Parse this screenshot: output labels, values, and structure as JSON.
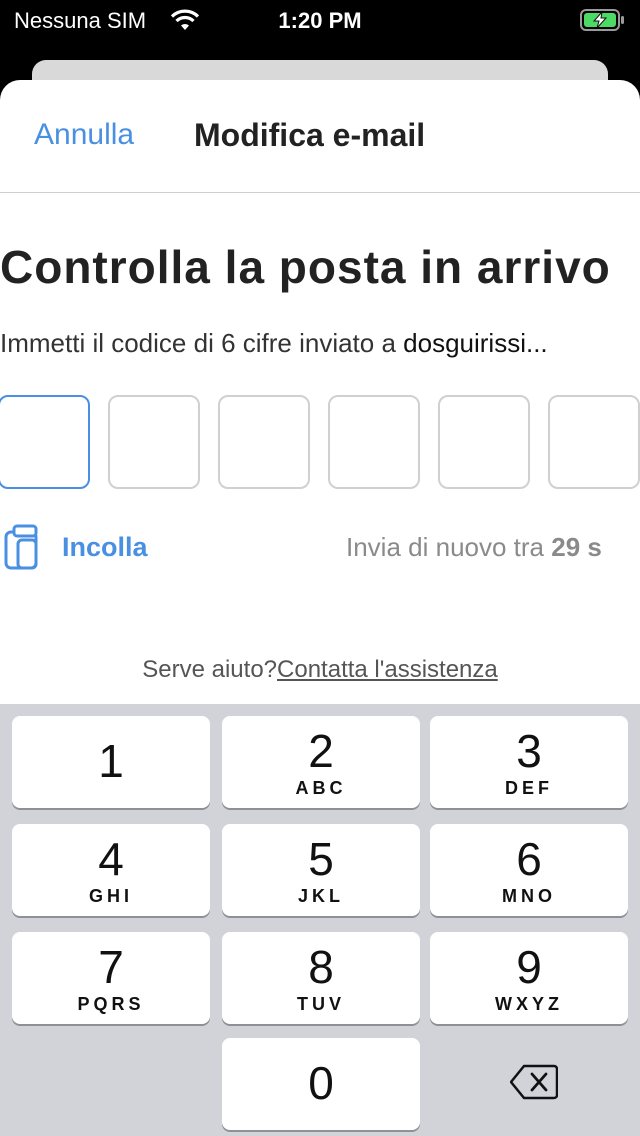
{
  "status_bar": {
    "carrier": "Nessuna SIM",
    "time": "1:20 PM",
    "wifi_icon": "wifi-icon",
    "battery_icon": "battery-charging-icon"
  },
  "nav": {
    "cancel_label": "Annulla",
    "title": "Modifica e-mail"
  },
  "main": {
    "heading": "Controlla la posta in arrivo",
    "subtext_prefix": "Immetti il codice di 6 cifre inviato a ",
    "email": "dosguirissi...",
    "code_boxes": [
      "",
      "",
      "",
      "",
      "",
      ""
    ],
    "paste_label": "Incolla",
    "resend_prefix": "Invia di nuovo tra ",
    "resend_seconds": "29 s",
    "help_prefix": "Serve aiuto?",
    "help_link": "Contatta l'assistenza"
  },
  "keyboard": {
    "keys": [
      {
        "num": "1",
        "letters": ""
      },
      {
        "num": "2",
        "letters": "ABC"
      },
      {
        "num": "3",
        "letters": "DEF"
      },
      {
        "num": "4",
        "letters": "GHI"
      },
      {
        "num": "5",
        "letters": "JKL"
      },
      {
        "num": "6",
        "letters": "MNO"
      },
      {
        "num": "7",
        "letters": "PQRS"
      },
      {
        "num": "8",
        "letters": "TUV"
      },
      {
        "num": "9",
        "letters": "WXYZ"
      },
      {
        "num": "0",
        "letters": ""
      }
    ]
  },
  "colors": {
    "accent": "#4a90e2",
    "keyboard_bg": "#d1d3d9",
    "battery_green": "#4cd964"
  }
}
